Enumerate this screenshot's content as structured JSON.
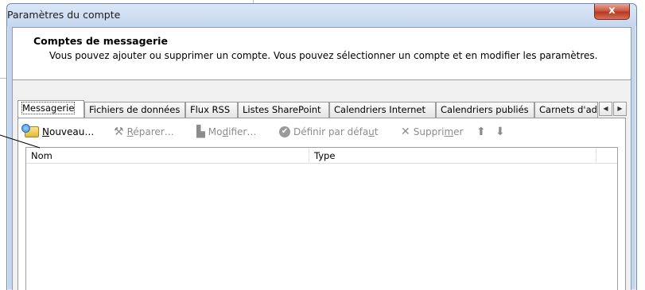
{
  "window": {
    "title": "Paramètres du compte",
    "close_glyph": "x"
  },
  "header": {
    "title": "Comptes de messagerie",
    "description": "Vous pouvez ajouter ou supprimer un compte. Vous pouvez sélectionner un compte et en modifier les paramètres."
  },
  "tabs": [
    {
      "label": "Messagerie"
    },
    {
      "label": "Fichiers de données"
    },
    {
      "label": "Flux RSS"
    },
    {
      "label": "Listes SharePoint"
    },
    {
      "label": "Calendriers Internet"
    },
    {
      "label": "Calendriers publiés"
    },
    {
      "label": "Carnets d'adresses"
    }
  ],
  "tab_scroll": {
    "left_glyph": "◀",
    "right_glyph": "▶"
  },
  "toolbar": {
    "new": {
      "pre": "",
      "key": "N",
      "post": "ouveau…"
    },
    "repair": {
      "pre": "",
      "key": "R",
      "post": "éparer…"
    },
    "modify": {
      "pre": "Mo",
      "key": "d",
      "post": "ifier…"
    },
    "set_default": {
      "pre": "Définir par défa",
      "key": "u",
      "post": "t"
    },
    "remove": {
      "pre": "Suppri",
      "key": "m",
      "post": "er"
    },
    "up_glyph": "⬆",
    "down_glyph": "⬇"
  },
  "list": {
    "columns": [
      "Nom",
      "Type"
    ]
  },
  "icons": {
    "new": "new-account-icon",
    "repair": "repair-tools-icon",
    "modify": "modify-icon",
    "set_default": "check-circle-icon",
    "remove": "delete-x-icon"
  }
}
